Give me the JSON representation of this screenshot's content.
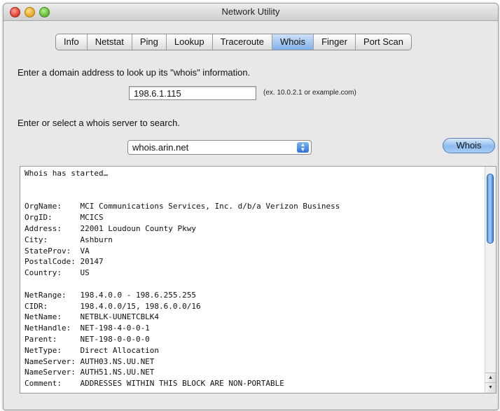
{
  "window": {
    "title": "Network Utility"
  },
  "tabs": [
    {
      "label": "Info"
    },
    {
      "label": "Netstat"
    },
    {
      "label": "Ping"
    },
    {
      "label": "Lookup"
    },
    {
      "label": "Traceroute"
    },
    {
      "label": "Whois",
      "active": true
    },
    {
      "label": "Finger"
    },
    {
      "label": "Port Scan"
    }
  ],
  "whois": {
    "domain_prompt": "Enter a domain address to look up its \"whois\" information.",
    "domain_value": "198.6.1.115",
    "domain_hint": "(ex. 10.0.2.1 or example.com)",
    "server_prompt": "Enter or select a whois server to search.",
    "server_value": "whois.arin.net",
    "button_label": "Whois"
  },
  "output": {
    "text": "Whois has started…\n\n\nOrgName:    MCI Communications Services, Inc. d/b/a Verizon Business\nOrgID:      MCICS\nAddress:    22001 Loudoun County Pkwy\nCity:       Ashburn\nStateProv:  VA\nPostalCode: 20147\nCountry:    US\n\nNetRange:   198.4.0.0 - 198.6.255.255\nCIDR:       198.4.0.0/15, 198.6.0.0/16\nNetName:    NETBLK-UUNETCBLK4\nNetHandle:  NET-198-4-0-0-1\nParent:     NET-198-0-0-0-0\nNetType:    Direct Allocation\nNameServer: AUTH03.NS.UU.NET\nNameServer: AUTH51.NS.UU.NET\nComment:    ADDRESSES WITHIN THIS BLOCK ARE NON-PORTABLE"
  },
  "colors": {
    "active_tab": "#7fb0e8",
    "button": "#8cbaf0",
    "window_bg": "#e8e8e8"
  },
  "icons": {
    "close": "close-traffic-light-icon",
    "minimize": "minimize-traffic-light-icon",
    "zoom": "zoom-traffic-light-icon",
    "popup": "chevron-up-down-icon",
    "scroll_up": "arrow-up-icon",
    "scroll_down": "arrow-down-icon"
  }
}
